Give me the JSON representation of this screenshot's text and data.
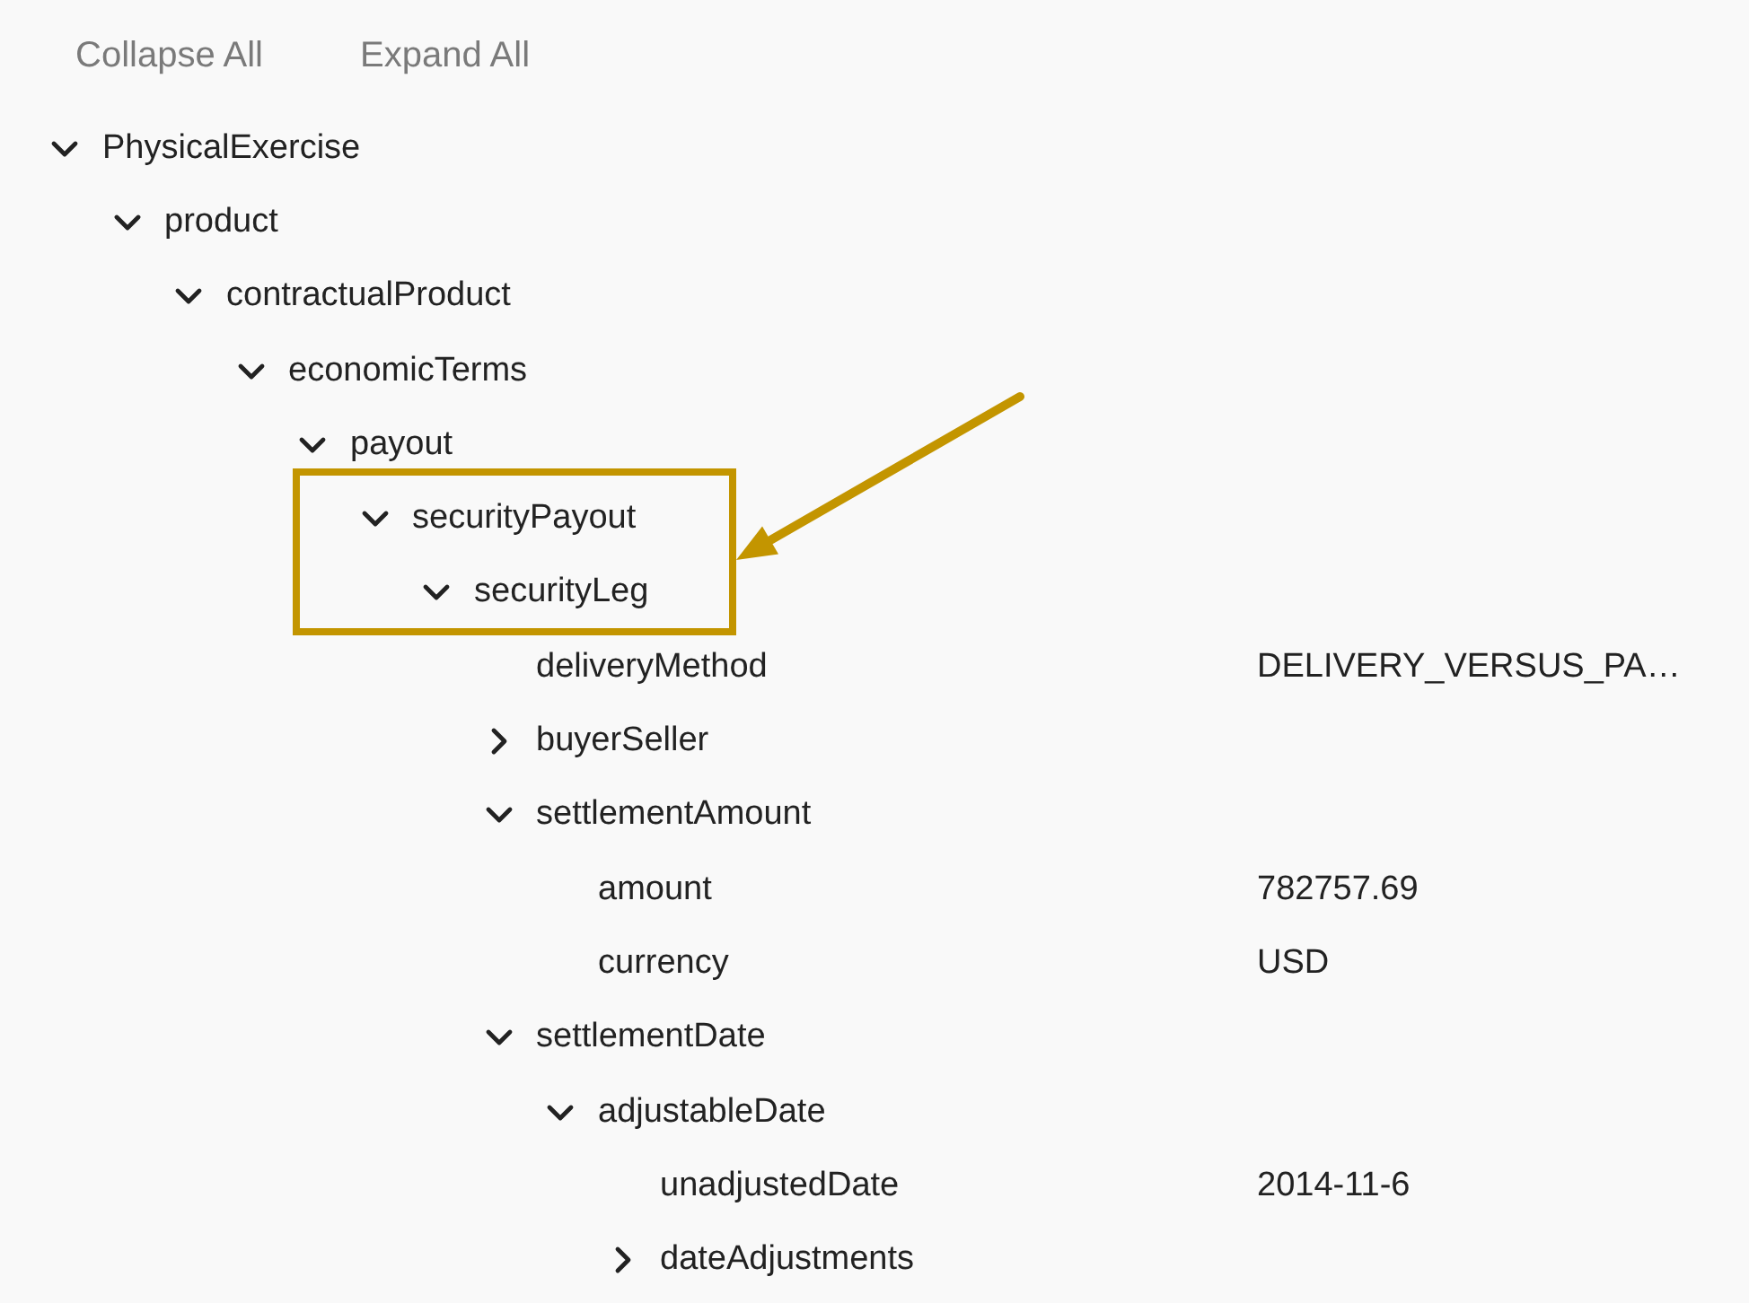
{
  "toolbar": [
    {
      "label": "Collapse All"
    },
    {
      "label": "Expand All"
    }
  ],
  "tree": [
    {
      "label": "PhysicalExercise",
      "expanded": true,
      "children": [
        {
          "label": "product",
          "expanded": true,
          "children": [
            {
              "label": "contractualProduct",
              "expanded": true,
              "children": [
                {
                  "label": "economicTerms",
                  "expanded": true,
                  "children": [
                    {
                      "label": "payout",
                      "expanded": true,
                      "children": [
                        {
                          "label": "securityPayout",
                          "expanded": true,
                          "highlighted": true,
                          "children": [
                            {
                              "label": "securityLeg",
                              "expanded": true,
                              "highlighted": true,
                              "children": [
                                {
                                  "label": "deliveryMethod",
                                  "value": "DELIVERY_VERSUS_PA…"
                                },
                                {
                                  "label": "buyerSeller",
                                  "expanded": false
                                },
                                {
                                  "label": "settlementAmount",
                                  "expanded": true,
                                  "children": [
                                    {
                                      "label": "amount",
                                      "value": "782757.69"
                                    },
                                    {
                                      "label": "currency",
                                      "value": "USD"
                                    }
                                  ]
                                },
                                {
                                  "label": "settlementDate",
                                  "expanded": true,
                                  "children": [
                                    {
                                      "label": "adjustableDate",
                                      "expanded": true,
                                      "children": [
                                        {
                                          "label": "unadjustedDate",
                                          "value": "2014-11-6"
                                        },
                                        {
                                          "label": "dateAdjustments",
                                          "expanded": false
                                        }
                                      ]
                                    }
                                  ]
                                }
                              ]
                            }
                          ]
                        }
                      ]
                    }
                  ]
                }
              ]
            }
          ]
        }
      ]
    }
  ]
}
